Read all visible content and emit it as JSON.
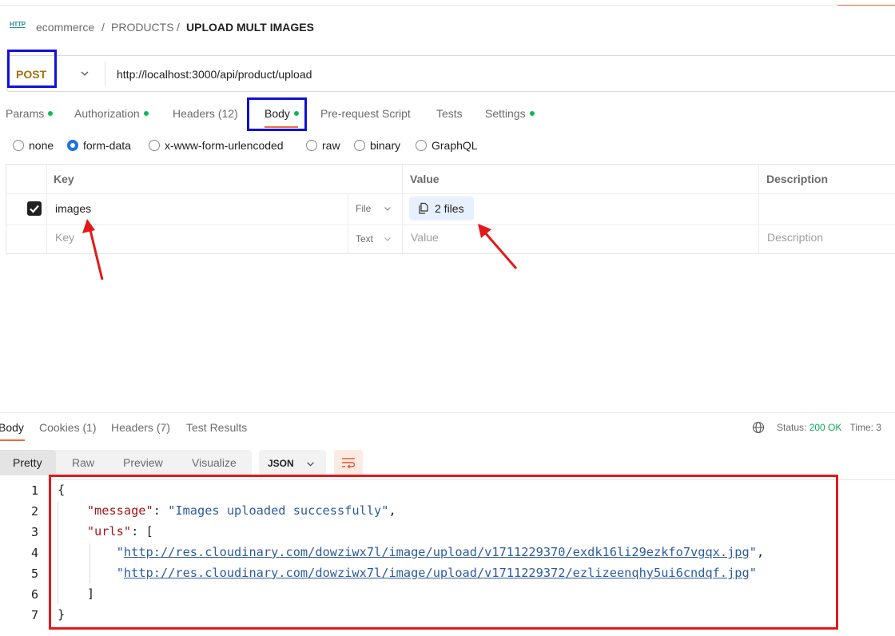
{
  "breadcrumb": {
    "icon": "http-icon",
    "icon_text": "HTTP",
    "items": [
      "ecommerce",
      "PRODUCTS"
    ],
    "separator": "/",
    "current": "UPLOAD MULT IMAGES"
  },
  "request": {
    "method": "POST",
    "url": "http://localhost:3000/api/product/upload"
  },
  "tabs": {
    "params": "Params",
    "authorization": "Authorization",
    "headers": "Headers",
    "headers_count": "(12)",
    "body": "Body",
    "prerequest": "Pre-request Script",
    "tests": "Tests",
    "settings": "Settings"
  },
  "body_types": {
    "none": "none",
    "form_data": "form-data",
    "urlencoded": "x-www-form-urlencoded",
    "raw": "raw",
    "binary": "binary",
    "graphql": "GraphQL",
    "selected": "form-data"
  },
  "form_table": {
    "headers": {
      "key": "Key",
      "value": "Value",
      "description": "Description"
    },
    "rows": [
      {
        "key": "images",
        "type": "File",
        "value": "2 files",
        "checked": true
      }
    ],
    "placeholder": {
      "key": "Key",
      "type": "Text",
      "value": "Value",
      "description": "Description"
    }
  },
  "response": {
    "tabs": {
      "body": "Body",
      "cookies": "Cookies",
      "cookies_count": "(1)",
      "headers": "Headers",
      "headers_count": "(7)",
      "test_results": "Test Results"
    },
    "status_label": "Status:",
    "status_value": "200 OK",
    "time_label": "Time: 3",
    "views": {
      "pretty": "Pretty",
      "raw": "Raw",
      "preview": "Preview",
      "visualize": "Visualize"
    },
    "format": "JSON",
    "code": {
      "line_numbers": [
        "1",
        "2",
        "3",
        "4",
        "5",
        "6",
        "7"
      ],
      "open_brace": "{",
      "message_key": "\"message\"",
      "message_value": "\"Images uploaded successfully\"",
      "urls_key": "\"urls\"",
      "url1": "http://res.cloudinary.com/dowziwx7l/image/upload/v1711229370/exdk16li29ezkfo7vgqx.jpg",
      "url2": "http://res.cloudinary.com/dowziwx7l/image/upload/v1711229372/ezlizeenqhy5ui6cndqf.jpg",
      "close_bracket": "]",
      "close_brace": "}"
    }
  },
  "colors": {
    "accent": "#f26b3a",
    "method": "#a37311",
    "dot": "#0cbb52",
    "annotation_blue": "#1010d8",
    "annotation_red": "#e21a1a"
  }
}
